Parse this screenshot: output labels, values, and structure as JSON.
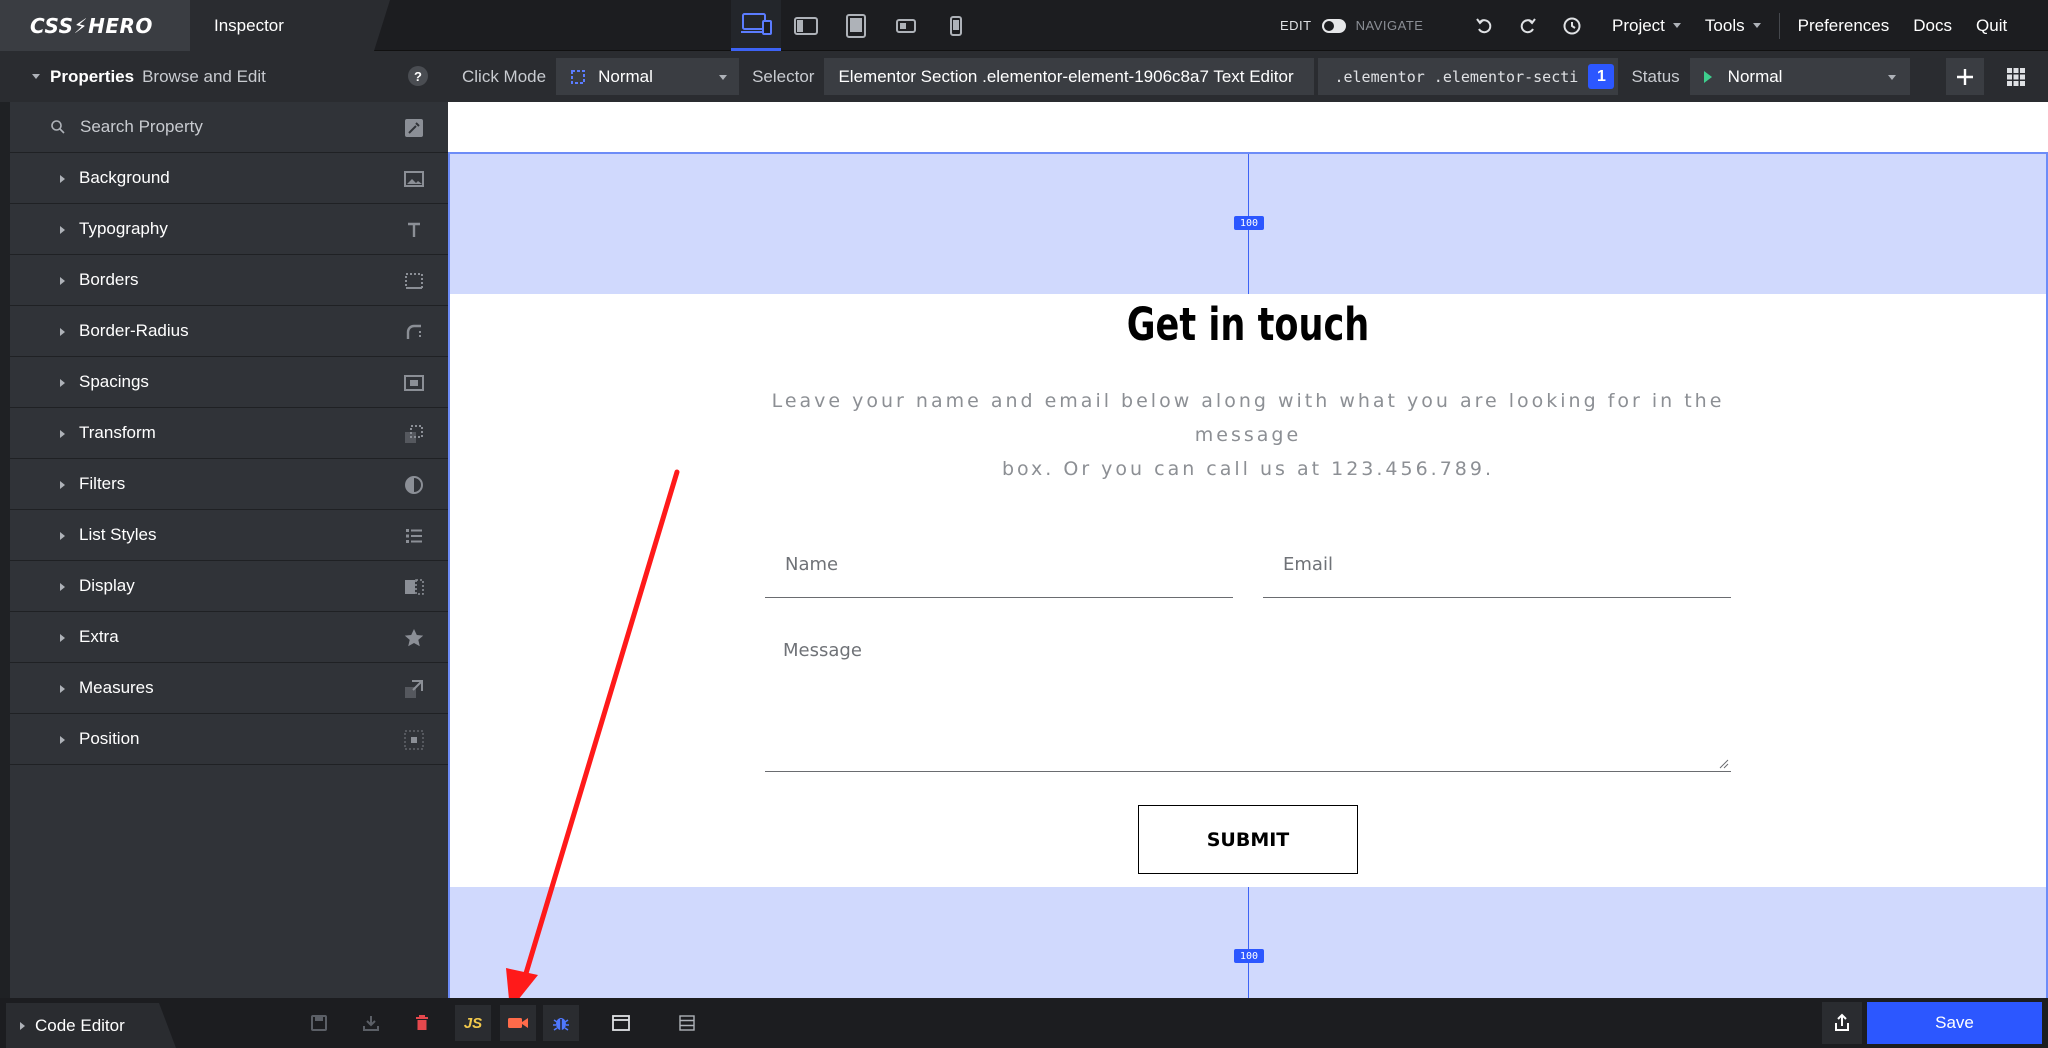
{
  "app": {
    "logo_text": "CSS⚡HERO",
    "panel_tab": "Inspector"
  },
  "topbar": {
    "edit_label": "EDIT",
    "navigate_label": "NAVIGATE",
    "menu": [
      "Project",
      "Tools",
      "Preferences",
      "Docs",
      "Quit"
    ]
  },
  "properties_panel": {
    "title": "Properties",
    "subtitle": "Browse and Edit",
    "help": "?",
    "search_placeholder": "Search Property",
    "items": [
      {
        "label": "Background",
        "icon": "image-icon"
      },
      {
        "label": "Typography",
        "icon": "text-icon"
      },
      {
        "label": "Borders",
        "icon": "borders-icon"
      },
      {
        "label": "Border-Radius",
        "icon": "border-radius-icon"
      },
      {
        "label": "Spacings",
        "icon": "spacings-icon"
      },
      {
        "label": "Transform",
        "icon": "transform-icon"
      },
      {
        "label": "Filters",
        "icon": "filters-icon"
      },
      {
        "label": "List Styles",
        "icon": "list-icon"
      },
      {
        "label": "Display",
        "icon": "display-icon"
      },
      {
        "label": "Extra",
        "icon": "star-icon"
      },
      {
        "label": "Measures",
        "icon": "measures-icon"
      },
      {
        "label": "Position",
        "icon": "position-icon"
      }
    ]
  },
  "selector_bar": {
    "click_mode_label": "Click Mode",
    "click_mode_value": "Normal",
    "selector_label": "Selector",
    "selector_value": "Elementor Section .elementor-element-1906c8a7 Text Editor",
    "selector_path": ".elementor .elementor-secti",
    "selector_count": "1",
    "status_label": "Status",
    "status_value": "Normal"
  },
  "canvas": {
    "padding_top_value": "100",
    "padding_bottom_value": "100",
    "heading": "Get in touch",
    "intro_line1": "Leave your name and email below along with what you are looking for in the message",
    "intro_line2": "box. Or you can call us at 123.456.789.",
    "name_placeholder": "Name",
    "email_placeholder": "Email",
    "message_placeholder": "Message",
    "submit_label": "SUBMIT"
  },
  "bottombar": {
    "code_editor_label": "Code Editor",
    "js_label": "JS",
    "save_label": "Save"
  },
  "colors": {
    "accent": "#2c57ff",
    "padding_highlight": "#d0d9fd",
    "annotation_arrow": "#ff1a1a",
    "delete": "#e5484d",
    "record": "#ff6b4a"
  }
}
